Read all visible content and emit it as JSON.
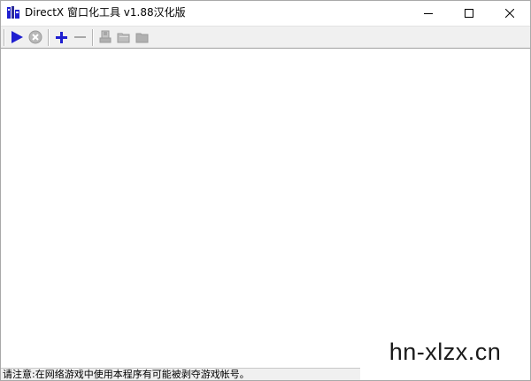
{
  "window": {
    "title": "DirectX 窗口化工具 v1.88汉化版"
  },
  "toolbar": {
    "buttons": [
      {
        "icon": "play-icon",
        "enabled": true
      },
      {
        "icon": "stop-icon",
        "enabled": false
      },
      {
        "icon": "add-icon",
        "enabled": true
      },
      {
        "icon": "remove-icon",
        "enabled": false
      },
      {
        "icon": "properties-icon",
        "enabled": false
      },
      {
        "icon": "folder-open-icon",
        "enabled": false
      },
      {
        "icon": "folder-icon",
        "enabled": false
      }
    ]
  },
  "statusbar": {
    "text": "请注意:在网络游戏中使用本程序有可能被剥夺游戏帐号。"
  },
  "watermark": {
    "text": "hn-xlzx.cn"
  },
  "colors": {
    "accent_blue": "#1f1fd0",
    "disabled_gray": "#a8a8a8",
    "toolbar_bg": "#f0f0f0"
  }
}
